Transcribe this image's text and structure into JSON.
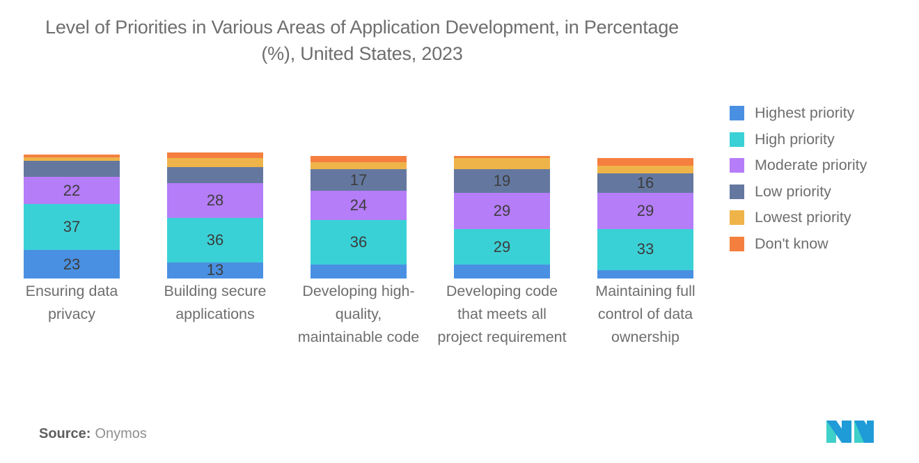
{
  "chart_data": {
    "type": "bar",
    "subtype": "stacked-column-100",
    "title": "Level of Priorities in Various Areas of Application Development, in Percentage (%), United States, 2023",
    "xlabel": "",
    "ylabel": "",
    "ylim": [
      0,
      100
    ],
    "grid": false,
    "legend_position": "right",
    "categories": [
      "Ensuring data privacy",
      "Building secure applications",
      "Developing high-quality, maintainable code",
      "Developing code that meets all project requirement",
      "Maintaining full control of data ownership"
    ],
    "series": [
      {
        "name": "Highest priority",
        "color": "#4a90e2",
        "values": [
          23,
          13,
          11,
          11,
          7
        ],
        "labels": [
          "23",
          "13",
          "",
          "",
          ""
        ]
      },
      {
        "name": "High priority",
        "color": "#3ad1d6",
        "values": [
          37,
          36,
          36,
          29,
          33
        ],
        "labels": [
          "37",
          "36",
          "36",
          "29",
          "33"
        ]
      },
      {
        "name": "Moderate priority",
        "color": "#b57df8",
        "values": [
          22,
          28,
          24,
          29,
          29
        ],
        "labels": [
          "22",
          "28",
          "24",
          "29",
          "29"
        ]
      },
      {
        "name": "Low priority",
        "color": "#64789f",
        "values": [
          13,
          13,
          17,
          19,
          16
        ],
        "labels": [
          "",
          "",
          "17",
          "19",
          "16"
        ]
      },
      {
        "name": "Lowest priority",
        "color": "#eeb44a",
        "values": [
          3,
          7,
          6,
          9,
          6
        ],
        "labels": [
          "",
          "",
          "",
          "",
          ""
        ]
      },
      {
        "name": "Don't know",
        "color": "#f47f3f",
        "values": [
          2,
          5,
          5,
          2,
          6
        ],
        "labels": [
          "",
          "",
          "",
          "",
          ""
        ]
      }
    ]
  },
  "footer": {
    "source_label": "Source:",
    "source_value": "Onymos"
  },
  "logo": {
    "name": "mordor-intelligence-logo",
    "color_left": "#3fd0c9",
    "color_right": "#1f9bd7"
  }
}
